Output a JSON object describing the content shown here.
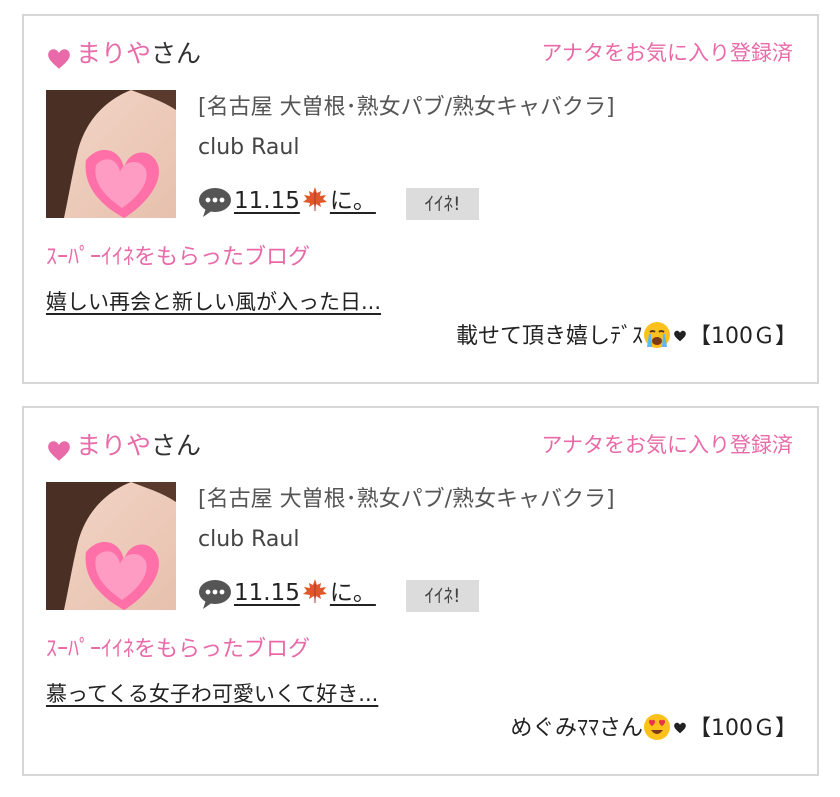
{
  "colors": {
    "accent": "#e86aa8",
    "border": "#d6d6d6",
    "button_bg": "#dcdcdc",
    "text": "#222222"
  },
  "cards": [
    {
      "user_name": "まりや",
      "user_suffix": "さん",
      "favorite_status": "アナタをお気に入り登録済",
      "shop_category": "[名古屋 大曽根･熟女パブ/熟女キャバクラ]",
      "shop_name": "club Raul",
      "post_title_pre": "11.15",
      "post_title_post": "に。",
      "post_icon": "speech-bubble-icon",
      "post_emoji": "maple-leaf-icon",
      "iine_label": "ｲｲﾈ!",
      "section_label": "ｽｰﾊﾟｰｲｲﾈをもらったブログ",
      "blog_title": "嬉しい再会と新しい風が入った日...",
      "comment_text": "載せて頂き嬉しﾃﾞｽ",
      "comment_emoji": "crying-face-icon",
      "points": "【100Ｇ】"
    },
    {
      "user_name": "まりや",
      "user_suffix": "さん",
      "favorite_status": "アナタをお気に入り登録済",
      "shop_category": "[名古屋 大曽根･熟女パブ/熟女キャバクラ]",
      "shop_name": "club Raul",
      "post_title_pre": "11.15",
      "post_title_post": "に。",
      "post_icon": "speech-bubble-icon",
      "post_emoji": "maple-leaf-icon",
      "iine_label": "ｲｲﾈ!",
      "section_label": "ｽｰﾊﾟｰｲｲﾈをもらったブログ",
      "blog_title": "慕ってくる女子わ可愛いくて好き...",
      "comment_text": "めぐみﾏﾏさん",
      "comment_emoji": "heart-eyes-face-icon",
      "points": "【100Ｇ】"
    }
  ]
}
